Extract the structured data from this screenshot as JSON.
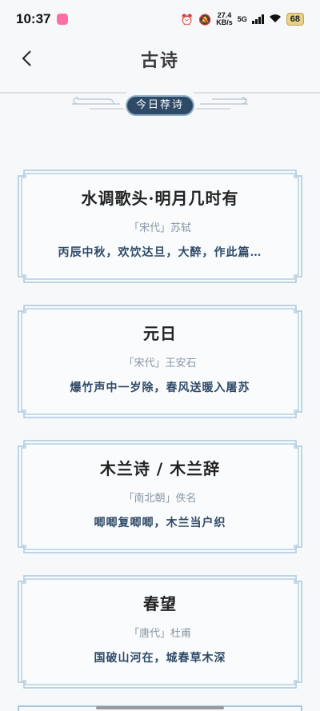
{
  "status_bar": {
    "time": "10:37",
    "net_speed_value": "27.4",
    "net_speed_unit": "KB/s",
    "network": "5G",
    "battery": "68"
  },
  "header": {
    "title": "古诗"
  },
  "banner": {
    "label": "今日荐诗"
  },
  "poems": [
    {
      "title": "水调歌头·明月几时有",
      "dynasty": "「宋代」",
      "author": "苏轼",
      "line": "丙辰中秋，欢饮达旦，大醉，作此篇…"
    },
    {
      "title": "元日",
      "dynasty": "「宋代」",
      "author": "王安石",
      "line": "爆竹声中一岁除，春风送暖入屠苏"
    },
    {
      "title": "木兰诗 / 木兰辞",
      "dynasty": "「南北朝」",
      "author": "佚名",
      "line": "唧唧复唧唧，木兰当户织"
    },
    {
      "title": "春望",
      "dynasty": "「唐代」",
      "author": "杜甫",
      "line": "国破山河在，城春草木深"
    }
  ],
  "colors": {
    "accent": "#2e4a66",
    "frame": "#a8c8dd",
    "line_text": "#2f4a68"
  }
}
